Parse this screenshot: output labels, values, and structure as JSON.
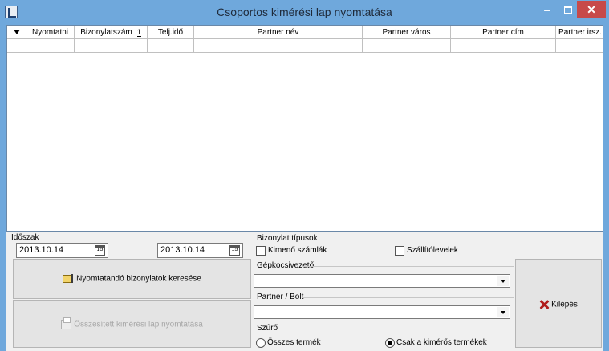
{
  "window": {
    "title": "Csoportos kimérési lap nyomtatása"
  },
  "grid": {
    "columns": [
      "Nyomtatni",
      "Bizonylatszám",
      "Telj.idő",
      "Partner név",
      "Partner város",
      "Partner cím",
      "Partner irsz."
    ],
    "sort_indicator": "1"
  },
  "period": {
    "label": "Időszak",
    "from": "2013.10.14",
    "to": "2013.10.14",
    "calendar_glyph": "15"
  },
  "doc_types": {
    "label": "Bizonylat típusok",
    "outgoing_invoices": "Kimenő számlák",
    "delivery_notes": "Szállítólevelek"
  },
  "buttons": {
    "search": "Nyomtatandó bizonylatok keresése",
    "print_summary": "Összesített kimérési lap nyomtatása",
    "exit": "Kilépés"
  },
  "driver": {
    "label": "Gépkocsivezető",
    "value": ""
  },
  "partner": {
    "label": "Partner / Bolt",
    "value": ""
  },
  "filter": {
    "label": "Szűrő",
    "all_products": "Összes termék",
    "measured_only": "Csak a kimérős termékek",
    "selected": "measured_only"
  }
}
